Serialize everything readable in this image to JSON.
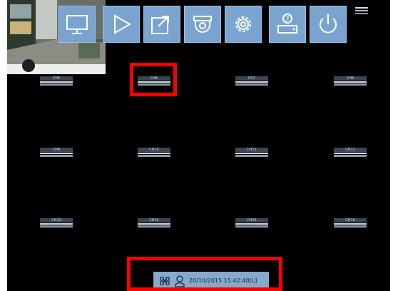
{
  "channels": [
    {
      "label": "CH5"
    },
    {
      "label": "CH6"
    },
    {
      "label": "CH7"
    },
    {
      "label": "CH8"
    },
    {
      "label": "CH9"
    },
    {
      "label": "CH10"
    },
    {
      "label": "CH11"
    },
    {
      "label": "CH12"
    },
    {
      "label": "CH13"
    },
    {
      "label": "CH14"
    },
    {
      "label": "CH15"
    },
    {
      "label": "CH16"
    }
  ],
  "status_bar": {
    "datetime": "20/10/2015 15:42:40[L]"
  },
  "toolbar": {
    "buttons": [
      {
        "icon": "monitor-icon"
      },
      {
        "icon": "play-icon"
      },
      {
        "icon": "export-icon"
      },
      {
        "icon": "ptz-camera-icon"
      },
      {
        "icon": "gear-icon"
      },
      {
        "icon": "help-icon"
      },
      {
        "icon": "power-icon"
      }
    ]
  },
  "colors": {
    "toolbar_bg": "#7aa4cf",
    "highlight": "#ff0000",
    "screen_bg": "#000000"
  }
}
